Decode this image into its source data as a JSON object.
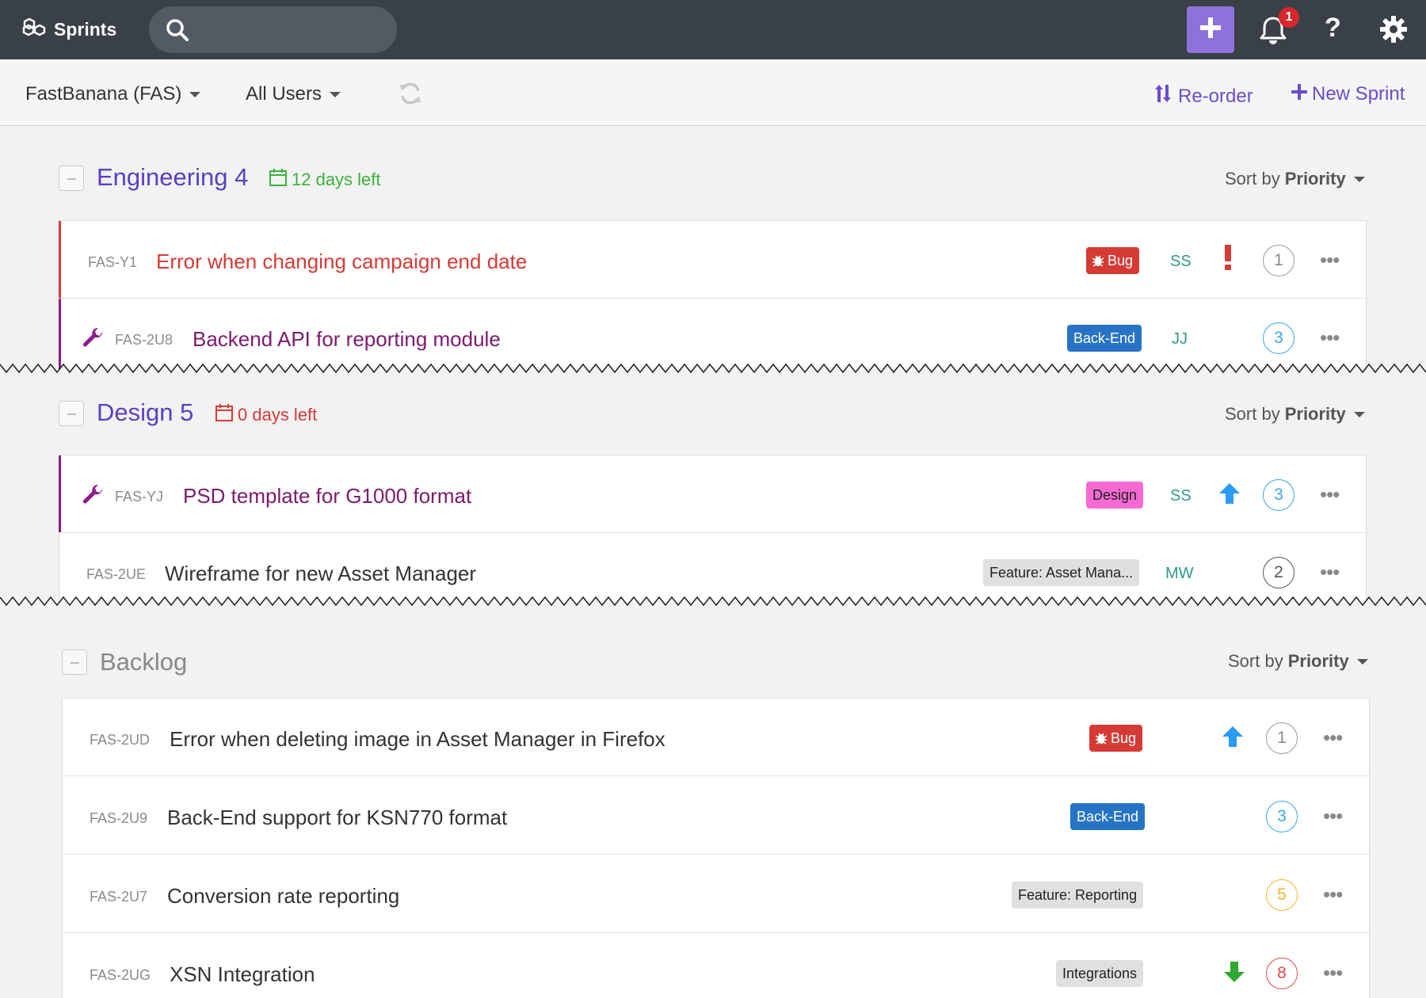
{
  "app": {
    "title": "Sprints"
  },
  "search": {
    "placeholder": ""
  },
  "notifications": {
    "count": "1"
  },
  "help": {
    "label": "?"
  },
  "toolbar": {
    "project": "FastBanana (FAS)",
    "users": "All Users",
    "reorder": "Re-order",
    "new_sprint": "New Sprint"
  },
  "sections": [
    {
      "title": "Engineering 4",
      "days_left": "12 days left",
      "sort_prefix": "Sort by",
      "sort_value": "Priority",
      "rows": [
        {
          "key": "FAS-Y1",
          "title": "Error when changing campaign end date",
          "tag": "Bug",
          "assignee": "SS",
          "priority": "critical",
          "points": "1"
        },
        {
          "key": "FAS-2U8",
          "title": "Backend API for reporting module",
          "tag": "Back-End",
          "assignee": "JJ",
          "priority": "",
          "points": "3"
        }
      ]
    },
    {
      "title": "Design 5",
      "days_left": "0 days left",
      "sort_prefix": "Sort by",
      "sort_value": "Priority",
      "rows": [
        {
          "key": "FAS-YJ",
          "title": "PSD template for G1000 format",
          "tag": "Design",
          "assignee": "SS",
          "priority": "high",
          "points": "3"
        },
        {
          "key": "FAS-2UE",
          "title": "Wireframe for new Asset Manager",
          "tag": "Feature: Asset Mana...",
          "assignee": "MW",
          "priority": "",
          "points": "2"
        }
      ]
    },
    {
      "title": "Backlog",
      "sort_prefix": "Sort by",
      "sort_value": "Priority",
      "rows": [
        {
          "key": "FAS-2UD",
          "title": "Error when deleting image in Asset Manager in Firefox",
          "tag": "Bug",
          "assignee": "",
          "priority": "high",
          "points": "1"
        },
        {
          "key": "FAS-2U9",
          "title": "Back-End support for KSN770 format",
          "tag": "Back-End",
          "assignee": "",
          "priority": "",
          "points": "3"
        },
        {
          "key": "FAS-2U7",
          "title": "Conversion rate reporting",
          "tag": "Feature: Reporting",
          "assignee": "",
          "priority": "",
          "points": "5"
        },
        {
          "key": "FAS-2UG",
          "title": "XSN Integration",
          "tag": "Integrations",
          "assignee": "",
          "priority": "low",
          "points": "8"
        }
      ]
    }
  ],
  "icons": {
    "brand": "cubes-icon",
    "search": "search-icon",
    "add": "plus-icon",
    "notifications": "bell-icon",
    "help": "question-icon",
    "settings": "gear-icon",
    "refresh": "refresh-icon",
    "reorder": "sort-arrows-icon",
    "new_sprint": "plus-icon",
    "collapse": "minus-icon",
    "calendar": "calendar-icon",
    "task_type": "wrench-icon",
    "bug": "bug-icon",
    "priority_critical": "exclamation-icon",
    "priority_high": "arrow-up-icon",
    "priority_low": "arrow-down-icon",
    "more": "ellipsis-icon"
  },
  "colors": {
    "topbar": "#3a4048",
    "accent": "#6a4dcc",
    "add_button": "#8f72d9",
    "bug_tag": "#d63a35",
    "backend_tag": "#2774c6",
    "design_tag": "#f66ad4",
    "neutral_tag": "#e0e0e0",
    "days_ok": "#3bb33b",
    "days_late": "#d63a35",
    "points_1": "#888888",
    "points_2": "#555555",
    "points_3": "#3aa5e8",
    "points_5": "#f0b429",
    "points_8": "#e04848"
  }
}
